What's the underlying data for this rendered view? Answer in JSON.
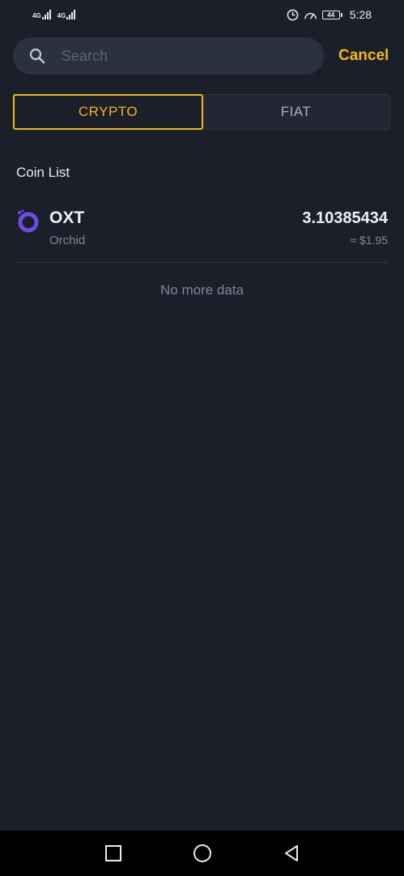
{
  "status_bar": {
    "network_1": "4G",
    "network_2": "4G",
    "battery": "44",
    "time": "5:28"
  },
  "search": {
    "placeholder": "Search",
    "value": "",
    "cancel_label": "Cancel"
  },
  "tabs": [
    {
      "label": "CRYPTO",
      "active": true
    },
    {
      "label": "FIAT",
      "active": false
    }
  ],
  "section_title": "Coin List",
  "coins": [
    {
      "symbol": "OXT",
      "name": "Orchid",
      "amount": "3.10385434",
      "fiat_value": "≈ $1.95",
      "icon": "orchid-logo-icon"
    }
  ],
  "footer_text": "No more data",
  "nav": {
    "recents": "square-icon",
    "home": "circle-icon",
    "back": "triangle-back-icon"
  },
  "colors": {
    "background": "#1b1f2a",
    "accent": "#f0b90b",
    "orchid": "#6f4ce5"
  }
}
